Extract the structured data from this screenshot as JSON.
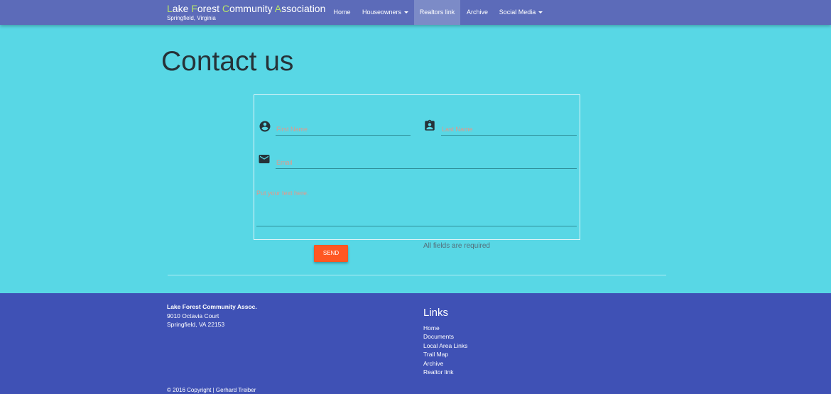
{
  "brand": {
    "title_parts": [
      {
        "initial": "L",
        "rest": "ake "
      },
      {
        "initial": "F",
        "rest": "orest "
      },
      {
        "initial": "C",
        "rest": "ommunity "
      },
      {
        "initial": "A",
        "rest": "ssociation"
      }
    ],
    "subtitle": "Springfield, Virginia"
  },
  "nav": {
    "home": "Home",
    "houseowners": "Houseowners",
    "realtors": "Realtors link",
    "archive": "Archive",
    "social": "Social Media"
  },
  "page": {
    "title": "Contact us"
  },
  "form": {
    "first_name_placeholder": "First Name",
    "last_name_placeholder": "Last Name",
    "email_placeholder": "Email",
    "message_placeholder": "Put your text here.",
    "send_label": "SEND",
    "required_note": "All fields are required"
  },
  "footer": {
    "address": {
      "name": "Lake Forest Community Assoc.",
      "street": "9010 Octavia Court",
      "city": "Springfield, VA 22153"
    },
    "links_title": "Links",
    "links": [
      "Home",
      "Documents",
      "Local Area Links",
      "Trail Map",
      "Archive",
      "Realtor link"
    ],
    "copyright": "© 2016 Copyright | Gerhard Treiber"
  },
  "colors": {
    "navbar": "#5c6bb9",
    "accent_initial": "#b6e36b",
    "page_bg": "#58d7e5",
    "send_button": "#ff5722",
    "footer_bg": "#3f51b5"
  },
  "icons": {
    "first_name": "account-circle-icon",
    "last_name": "contact-card-icon",
    "email": "email-icon"
  }
}
